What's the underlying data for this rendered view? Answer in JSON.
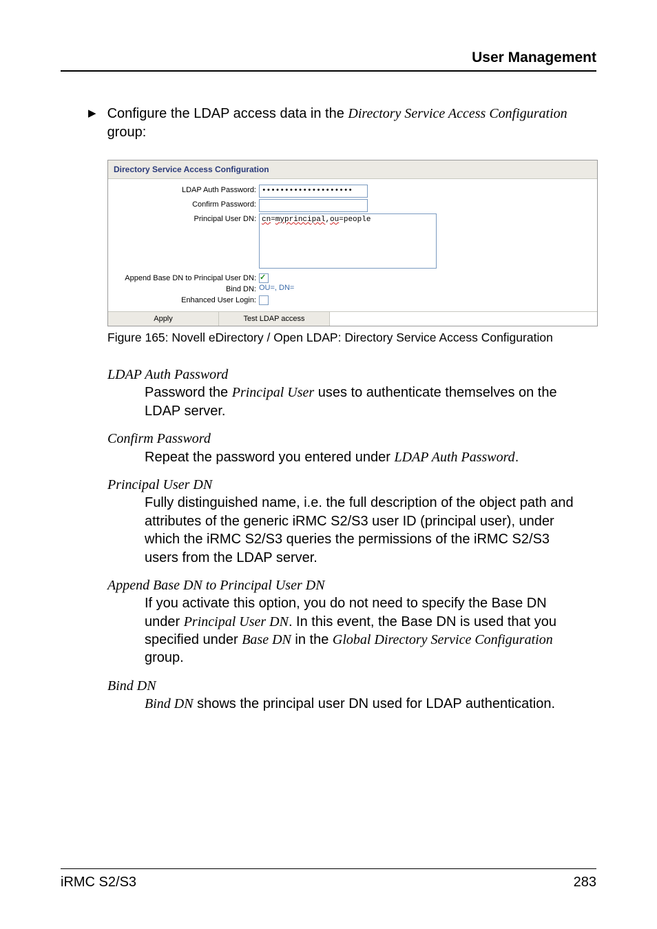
{
  "header": {
    "title": "User Management"
  },
  "intro": {
    "lead": "Configure the LDAP access data in the ",
    "italic": "Directory Service Access Configuration",
    "trail": " group:"
  },
  "shot": {
    "title": "Directory Service Access Configuration",
    "labels": {
      "ldap_auth_password": "LDAP Auth Password:",
      "confirm_password": "Confirm Password:",
      "principal_user_dn": "Principal User DN:",
      "append_base_dn": "Append Base DN to Principal User DN:",
      "bind_dn_label": "Bind DN:",
      "enhanced_user_login": "Enhanced User Login:"
    },
    "values": {
      "ldap_auth_password": "••••••••••••••••••••",
      "confirm_password": "",
      "principal_user_dn_1a": "cn",
      "principal_user_dn_1b": "=",
      "principal_user_dn_1c": "myprincipal",
      "principal_user_dn_1d": ",",
      "principal_user_dn_1e": "ou",
      "principal_user_dn_1f": "=people",
      "append_base_dn_checked": true,
      "bind_dn_value": "OU=, DN=",
      "enhanced_user_login_checked": false
    },
    "buttons": {
      "apply": "Apply",
      "test": "Test LDAP access"
    }
  },
  "caption": "Figure 165: Novell eDirectory / Open LDAP: Directory Service Access Configuration",
  "defs": {
    "d1": {
      "term": "LDAP Auth Password",
      "body_a": "Password the ",
      "body_i": "Principal User",
      "body_b": " uses to authenticate themselves on the LDAP server."
    },
    "d2": {
      "term": "Confirm Password",
      "body_a": "Repeat the password you entered under ",
      "body_i": "LDAP Auth Password",
      "body_b": "."
    },
    "d3": {
      "term": "Principal User DN",
      "body": "Fully distinguished name, i.e. the full description of the object path and attributes of the generic iRMC S2/S3 user ID (principal user), under which the iRMC S2/S3 queries the permissions of the iRMC S2/S3 users from the LDAP server."
    },
    "d4": {
      "term": "Append Base DN to Principal User DN",
      "body_a": "If you activate this option, you do not need to specify the Base DN under ",
      "body_i1": "Principal User DN",
      "body_b": ". In this event, the Base DN is used that you specified under ",
      "body_i2": "Base DN",
      "body_c": " in the ",
      "body_i3": "Global Directory Service Configuration",
      "body_d": " group."
    },
    "d5": {
      "term": "Bind DN",
      "body_i": "Bind DN",
      "body_a": " shows the principal user DN used for LDAP authentication."
    }
  },
  "footer": {
    "left": "iRMC S2/S3",
    "right": "283"
  }
}
